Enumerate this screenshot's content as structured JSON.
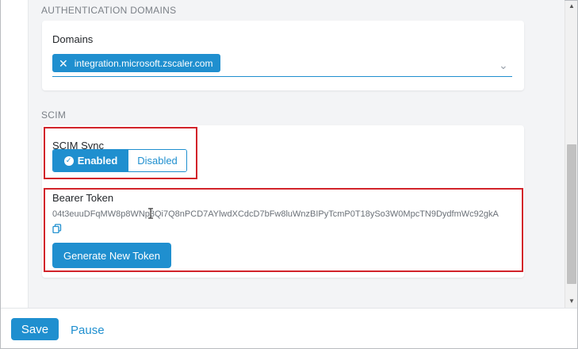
{
  "auth": {
    "section_heading": "AUTHENTICATION DOMAINS",
    "domains_label": "Domains",
    "chip_value": "integration.microsoft.zscaler.com",
    "chip_remove_glyph": "✕",
    "dropdown_glyph": "⌄"
  },
  "scim": {
    "section_heading": "SCIM",
    "sync_label": "SCIM Sync",
    "enabled_label": "Enabled",
    "disabled_label": "Disabled",
    "selected": "Enabled",
    "bearer_label": "Bearer Token",
    "token": "04t3euuDFqMW8p8WNp3Qi7Q8nPCD7AYlwdXCdcD7bFw8luWnzBIPyTcmP0T18ySo3W0MpcTN9DydfmWc92gkA",
    "generate_label": "Generate New Token"
  },
  "footer": {
    "save_label": "Save",
    "pause_label": "Pause"
  },
  "colors": {
    "accent": "#1f8fcf",
    "highlight_red": "#d2232a",
    "panel_bg": "#f3f4f6"
  },
  "icons": [
    "close-icon",
    "chevron-down-icon",
    "check-circle-icon",
    "copy-icon",
    "scroll-up-arrow-icon",
    "scroll-down-arrow-icon",
    "text-cursor-icon"
  ]
}
